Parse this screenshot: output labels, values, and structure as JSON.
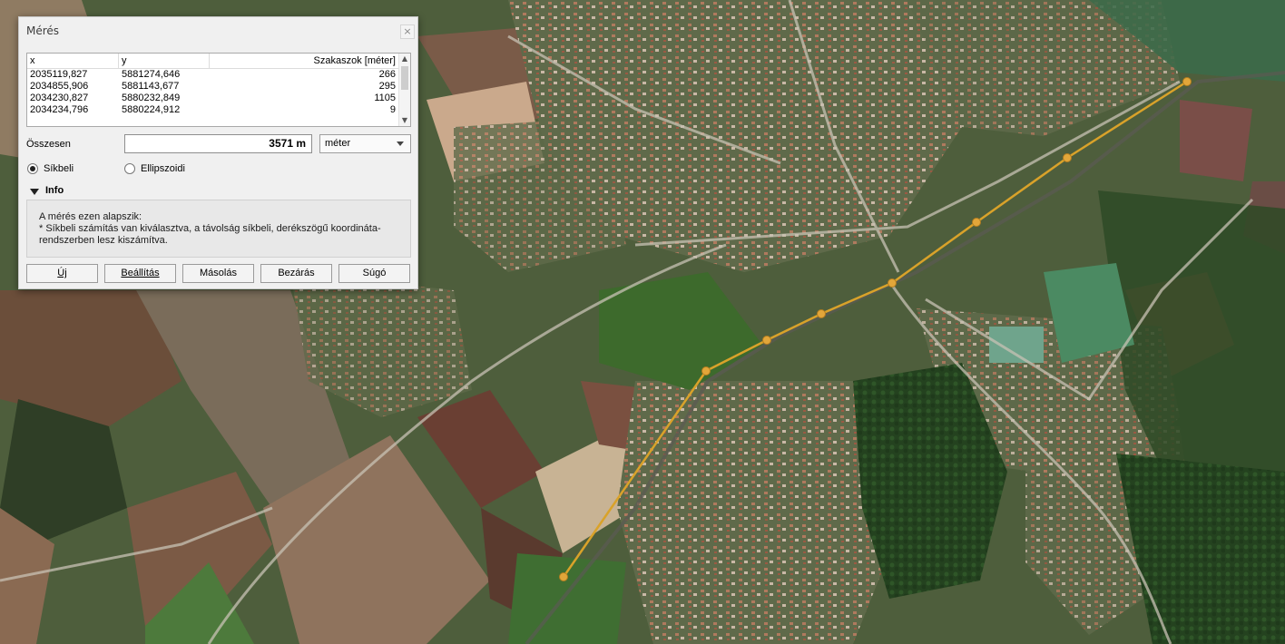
{
  "dialog": {
    "title": "Mérés",
    "close_glyph": "×",
    "table": {
      "headers": [
        "x",
        "y",
        "Szakaszok [méter]"
      ],
      "rows": [
        [
          "2035119,827",
          "5881274,646",
          "266"
        ],
        [
          "2034855,906",
          "5881143,677",
          "295"
        ],
        [
          "2034230,827",
          "5880232,849",
          "1105"
        ],
        [
          "2034234,796",
          "5880224,912",
          "9"
        ]
      ]
    },
    "total_label": "Összesen",
    "total_value": "3571 m",
    "unit_selected": "méter",
    "radio_planar": "Síkbeli",
    "radio_ellipsoidal": "Ellipszoidi",
    "info_title": "Info",
    "info_line1": "A mérés ezen alapszik:",
    "info_line2": "* Síkbeli számítás van kiválasztva, a távolság síkbeli, derékszögű koordináta-",
    "info_line3": "rendszerben lesz kiszámítva.",
    "buttons": {
      "new": "Új",
      "settings": "Beállítás",
      "copy": "Másolás",
      "close": "Bezárás",
      "help": "Súgó"
    }
  },
  "map": {
    "measure_line_color": "#d9a22a"
  }
}
